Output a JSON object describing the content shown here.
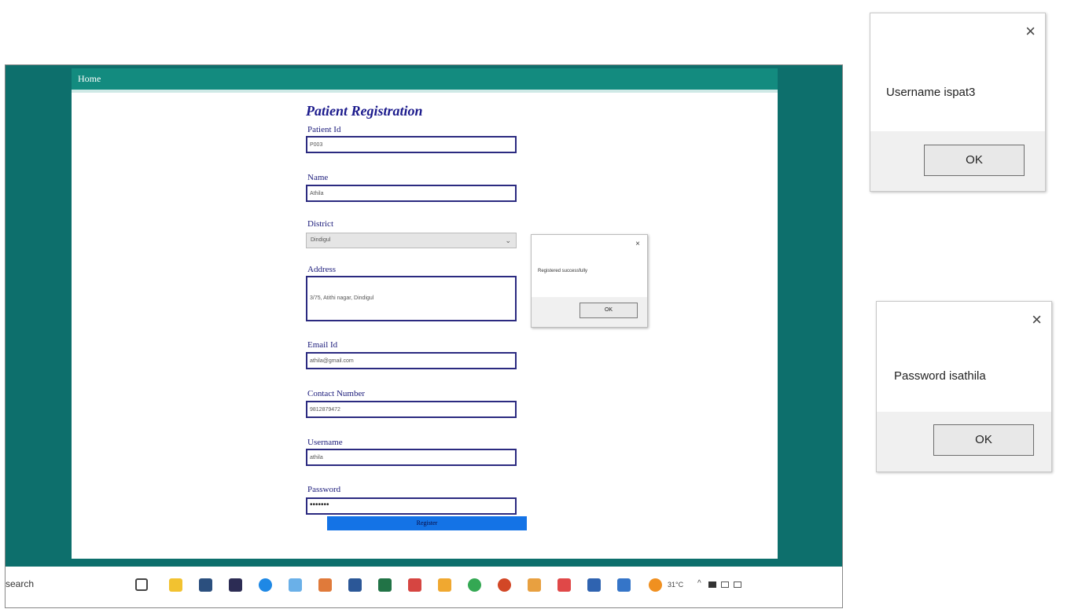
{
  "app": {
    "nav_home": "Home",
    "form_title": "Patient Registration",
    "fields": [
      {
        "label": "Patient Id",
        "value": "P003"
      },
      {
        "label": "Name",
        "value": "Athila"
      },
      {
        "label": "District",
        "value": "Dindigul"
      },
      {
        "label": "Address",
        "value": "3/75, Atithi nagar, Dindigul"
      },
      {
        "label": "Email Id",
        "value": "athila@gmail.com"
      },
      {
        "label": "Contact Number",
        "value": "9812879472"
      },
      {
        "label": "Username",
        "value": "athila"
      },
      {
        "label": "Password",
        "value": "•••••••"
      }
    ],
    "register_label": "Register"
  },
  "inapp_alert": {
    "close": "×",
    "message": "Registered successfully",
    "ok": "OK"
  },
  "taskbar": {
    "search_text": "search",
    "temperature": "31°C",
    "tray": "^"
  },
  "dialog_username": {
    "close": "×",
    "message": "Username ispat3",
    "ok": "OK"
  },
  "dialog_password": {
    "close": "×",
    "message": "Password isathila",
    "ok": "OK"
  },
  "colors": {
    "outer_teal": "#0d6f6c",
    "navbar": "#138b7f",
    "register_button": "#1473e6",
    "form_text": "#1b1a8c"
  }
}
